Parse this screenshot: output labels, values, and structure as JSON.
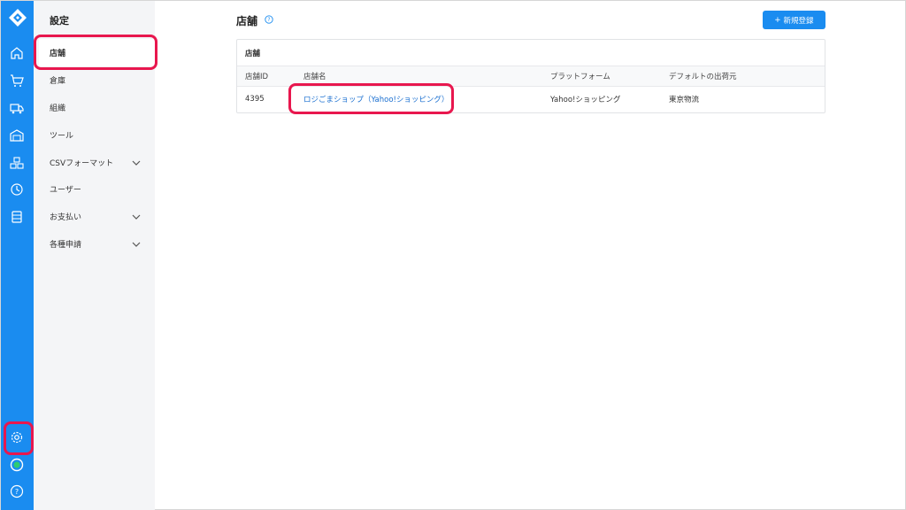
{
  "sidebar": {
    "title": "設定",
    "items": [
      {
        "label": "店舗"
      },
      {
        "label": "倉庫"
      },
      {
        "label": "組織"
      },
      {
        "label": "ツール"
      },
      {
        "label": "CSVフォーマット"
      },
      {
        "label": "ユーザー"
      },
      {
        "label": "お支払い"
      },
      {
        "label": "各種申請"
      }
    ]
  },
  "header": {
    "title": "店舗",
    "new_button": "新規登録"
  },
  "card": {
    "title": "店舗",
    "columns": [
      "店舗ID",
      "店舗名",
      "プラットフォーム",
      "デフォルトの出荷元"
    ],
    "rows": [
      {
        "id": "4395",
        "name": "ロジごまショップ（Yahoo!ショッピング）",
        "platform": "Yahoo!ショッピング",
        "origin": "東京物流"
      }
    ]
  },
  "colors": {
    "accent": "#1a8cf0",
    "highlight": "#e8174e"
  }
}
